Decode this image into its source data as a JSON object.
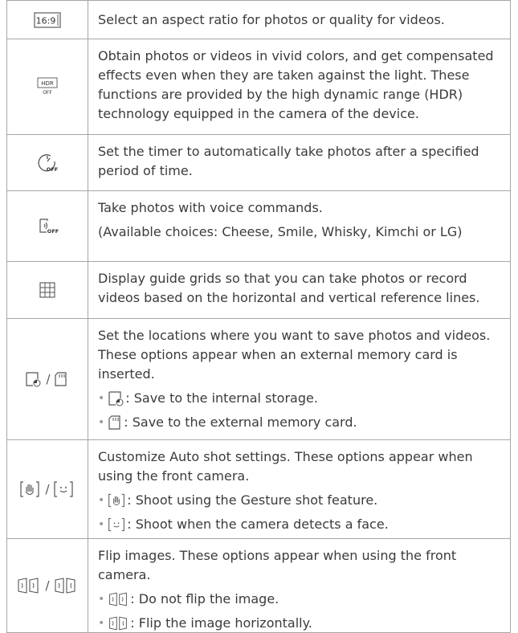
{
  "rows": [
    {
      "icon": "aspect-ratio-16-9-icon",
      "icon_text": "16:9",
      "lines": [
        "Select an aspect ratio for photos or quality for videos."
      ]
    },
    {
      "icon": "hdr-off-icon",
      "icon_text": "HDR",
      "icon_subtext": "OFF",
      "lines": [
        "Obtain photos or videos in vivid colors, and get compensated effects even when they are taken against the light. These functions are provided by the high dynamic range (HDR) technology equipped in the camera of the device."
      ]
    },
    {
      "icon": "timer-off-icon",
      "icon_subtext": "OFF",
      "lines": [
        "Set the timer to automatically take photos after a specified period of time."
      ]
    },
    {
      "icon": "voice-shutter-off-icon",
      "icon_subtext": "OFF",
      "lines": [
        "Take photos with voice commands.",
        "(Available choices: Cheese, Smile, Whisky, Kimchi or LG)"
      ]
    },
    {
      "icon": "grid-icon",
      "lines": [
        "Display guide grids so that you can take photos or record videos based on the horizontal and vertical reference lines."
      ]
    },
    {
      "icon": "storage-icon",
      "separator": "/",
      "lines": [
        "Set the locations where you want to save photos and videos. These options appear when an external memory card is inserted."
      ],
      "bullets": [
        {
          "icon": "internal-storage-icon",
          "text": ": Save to the internal storage."
        },
        {
          "icon": "sd-card-icon",
          "text": " : Save to the external memory card."
        }
      ]
    },
    {
      "icon": "auto-shot-icon",
      "separator": "/",
      "lines": [
        "Customize Auto shot settings. These options appear when using the front camera."
      ],
      "bullets": [
        {
          "icon": "gesture-shot-icon",
          "text": ": Shoot using the Gesture shot feature."
        },
        {
          "icon": "face-detect-icon",
          "text": ": Shoot when the camera detects a face."
        }
      ]
    },
    {
      "icon": "flip-icon",
      "separator": "/",
      "lines": [
        "Flip images. These options appear when using the front camera."
      ],
      "bullets": [
        {
          "icon": "no-flip-icon",
          "text": ": Do not flip the image."
        },
        {
          "icon": "flip-horizontal-icon",
          "text": ": Flip the image horizontally."
        }
      ]
    }
  ]
}
